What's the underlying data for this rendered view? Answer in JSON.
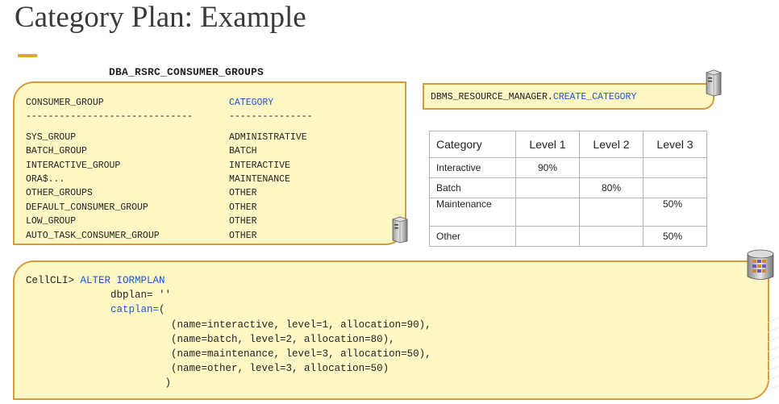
{
  "slide": {
    "title": "Category Plan: Example"
  },
  "consumer_panel": {
    "label": "DBA_RSRC_CONSUMER_GROUPS",
    "header": {
      "col1": "CONSUMER_GROUP",
      "col2": "CATEGORY"
    },
    "separator": {
      "col1": "------------------------------",
      "col2": "---------------"
    },
    "rows": [
      {
        "group": "SYS_GROUP",
        "category": "ADMINISTRATIVE"
      },
      {
        "group": "BATCH_GROUP",
        "category": "BATCH"
      },
      {
        "group": "INTERACTIVE_GROUP",
        "category": "INTERACTIVE"
      },
      {
        "group": "ORA$...",
        "category": "MAINTENANCE"
      },
      {
        "group": "OTHER_GROUPS",
        "category": "OTHER"
      },
      {
        "group": "DEFAULT_CONSUMER_GROUP",
        "category": "OTHER"
      },
      {
        "group": "LOW_GROUP",
        "category": "OTHER"
      },
      {
        "group": "AUTO_TASK_CONSUMER_GROUP",
        "category": "OTHER"
      }
    ]
  },
  "api_box": {
    "package": "DBMS_RESOURCE_MANAGER.",
    "procedure": "CREATE_CATEGORY"
  },
  "level_table": {
    "headers": [
      "Category",
      "Level 1",
      "Level 2",
      "Level 3"
    ],
    "rows": [
      [
        "Interactive",
        "90%",
        "",
        ""
      ],
      [
        "Batch",
        "",
        "80%",
        ""
      ],
      [
        "Maintenance",
        "",
        "",
        "50%"
      ],
      [
        "Other",
        "",
        "",
        "50%"
      ]
    ]
  },
  "cellcli": {
    "prompt": "CellCLI> ",
    "command": "ALTER IORMPLAN",
    "dbplan_line": "dbplan= ''",
    "catplan_key": "catplan=",
    "catplan_open": "(",
    "directives": [
      "(name=interactive, level=1, allocation=90),",
      "(name=batch, level=2, allocation=80),",
      "(name=maintenance, level=3, allocation=50),",
      "(name=other, level=3, allocation=50)"
    ],
    "close": ")"
  },
  "icons": [
    "server-icon",
    "database-icon"
  ],
  "colors": {
    "accent": "#e0a43a",
    "box_border": "#d99a3a",
    "box_fill": "#fff7c4",
    "keyword": "#1a55d6"
  }
}
